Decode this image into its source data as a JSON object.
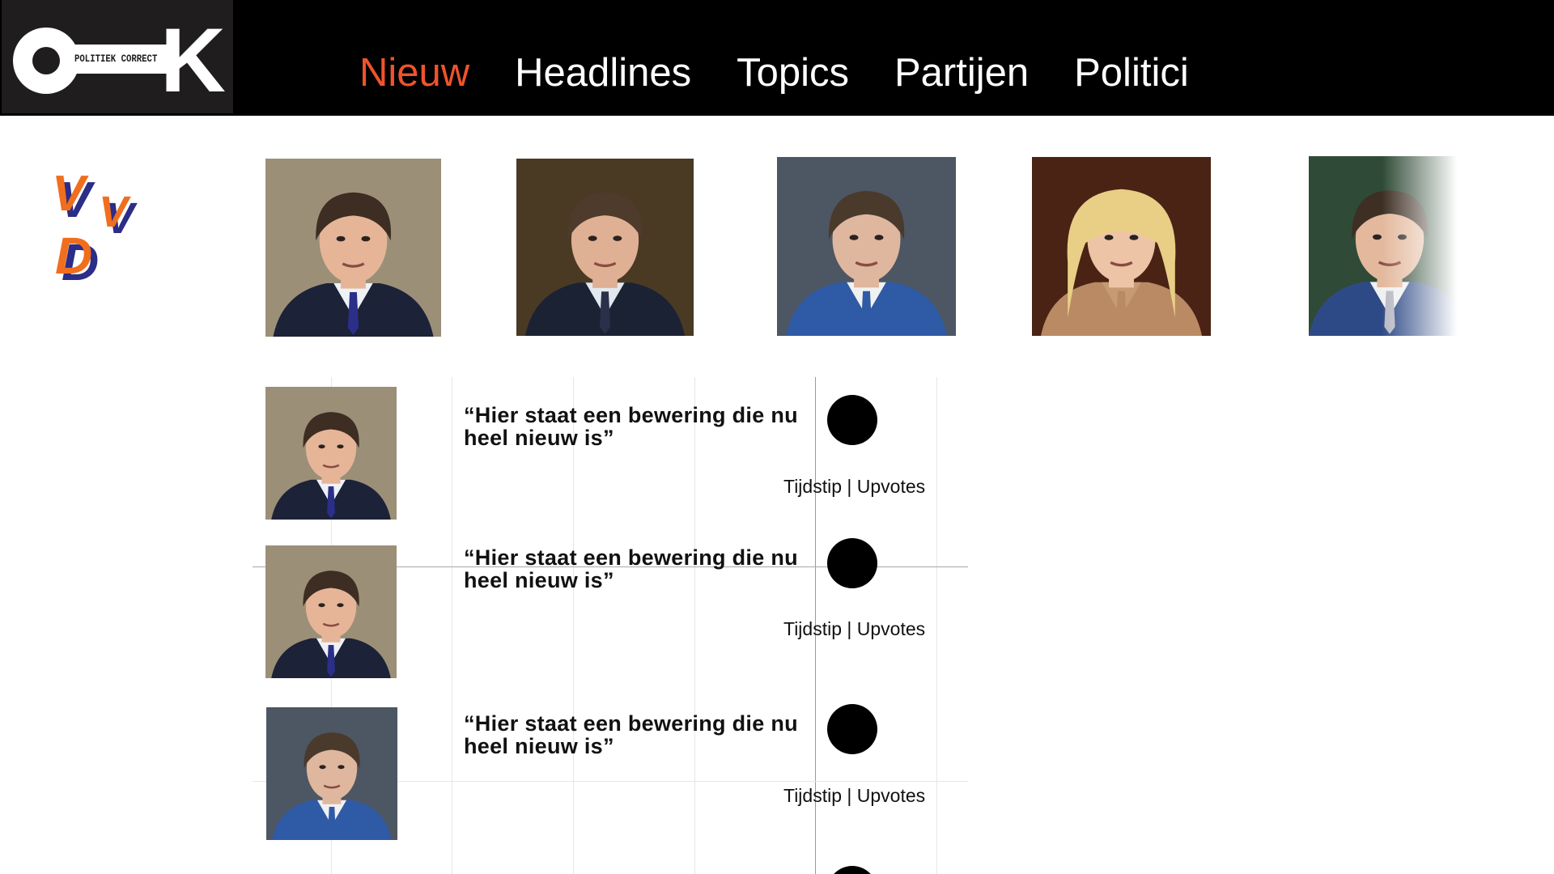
{
  "logo": {
    "small_text": "POLITIEK CORRECT",
    "big_letter": "K"
  },
  "nav": {
    "items": [
      {
        "label": "Nieuw",
        "active": true
      },
      {
        "label": "Headlines",
        "active": false
      },
      {
        "label": "Topics",
        "active": false
      },
      {
        "label": "Partijen",
        "active": false
      },
      {
        "label": "Politici",
        "active": false
      }
    ]
  },
  "party": {
    "logo_text": "VVD",
    "orange": "#f06e1e",
    "blue": "#2b2d86"
  },
  "politicians": [
    {
      "palette": {
        "bg": "#9c8f78",
        "skin": "#e6b598",
        "hair": "#3d2d22",
        "suit": "#1c2238",
        "shirt": "#eef1f6",
        "tie": "#2b2f8a"
      }
    },
    {
      "palette": {
        "bg": "#4a3a24",
        "skin": "#e0b094",
        "hair": "#4e3b2b",
        "suit": "#1b2233",
        "shirt": "#e2e8ef",
        "tie": "#29304a"
      }
    },
    {
      "palette": {
        "bg": "#4d5663",
        "skin": "#dfb69e",
        "hair": "#4a3a2c",
        "suit": "#2f5aa6",
        "shirt": "#f1f1f1",
        "tie": "#2f5aa6"
      }
    },
    {
      "palette": {
        "bg": "#4a2315",
        "skin": "#edc4a6",
        "hair": "#e9cf86",
        "suit": "#b98a64",
        "shirt": "#c79a73",
        "tie": "#b98a64"
      }
    },
    {
      "palette": {
        "bg": "#2f4a36",
        "skin": "#e3b89c",
        "hair": "#3d2f24",
        "suit": "#2e4a86",
        "shirt": "#f0f0f2",
        "tie": "#b8b8c2"
      }
    }
  ],
  "feed": [
    {
      "claim": "“Hier staat een bewering die nu heel nieuw is”",
      "meta": "Tijdstip | Upvotes",
      "politician": 0
    },
    {
      "claim": "“Hier staat een bewering die nu heel nieuw is”",
      "meta": "Tijdstip | Upvotes",
      "politician": 0
    },
    {
      "claim": "“Hier staat een bewering die nu heel nieuw is”",
      "meta": "Tijdstip | Upvotes",
      "politician": 2
    }
  ]
}
